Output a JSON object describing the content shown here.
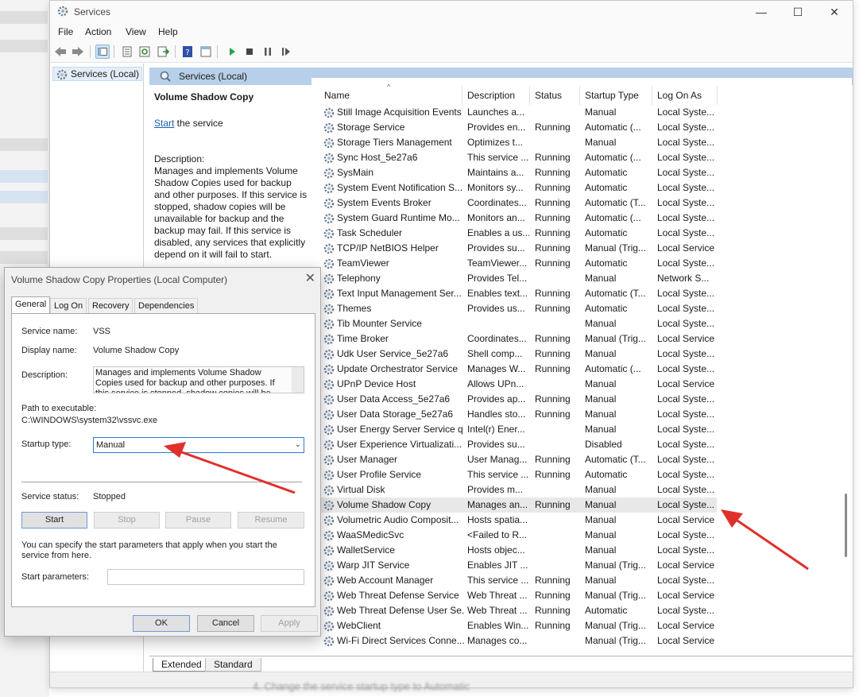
{
  "window": {
    "title": "Services",
    "controls": {
      "minimize": "—",
      "maximize": "☐",
      "close": "✕"
    }
  },
  "menu": [
    "File",
    "Action",
    "View",
    "Help"
  ],
  "toolbar_icons": [
    "back-icon",
    "forward-icon",
    "show-hide-console-tree-icon",
    "properties-icon",
    "refresh-icon",
    "export-list-icon",
    "help-icon",
    "view-icon",
    "start-service-icon",
    "stop-service-icon",
    "pause-service-icon",
    "resume-service-icon"
  ],
  "tree": {
    "item": "Services (Local)"
  },
  "pane_header": "Services (Local)",
  "details": {
    "title": "Volume Shadow Copy",
    "start_link": "Start",
    "start_suffix": " the service",
    "description_label": "Description:",
    "description": "Manages and implements Volume Shadow Copies used for backup and other purposes. If this service is stopped, shadow copies will be unavailable for backup and the backup may fail. If this service is disabled, any services that explicitly depend on it will fail to start."
  },
  "columns": [
    "Name",
    "Description",
    "Status",
    "Startup Type",
    "Log On As"
  ],
  "services": [
    {
      "name": "Still Image Acquisition Events",
      "desc": "Launches a...",
      "status": "",
      "startup": "Manual",
      "logon": "Local Syste..."
    },
    {
      "name": "Storage Service",
      "desc": "Provides en...",
      "status": "Running",
      "startup": "Automatic (...",
      "logon": "Local Syste..."
    },
    {
      "name": "Storage Tiers Management",
      "desc": "Optimizes t...",
      "status": "",
      "startup": "Manual",
      "logon": "Local Syste..."
    },
    {
      "name": "Sync Host_5e27a6",
      "desc": "This service ...",
      "status": "Running",
      "startup": "Automatic (...",
      "logon": "Local Syste..."
    },
    {
      "name": "SysMain",
      "desc": "Maintains a...",
      "status": "Running",
      "startup": "Automatic",
      "logon": "Local Syste..."
    },
    {
      "name": "System Event Notification S...",
      "desc": "Monitors sy...",
      "status": "Running",
      "startup": "Automatic",
      "logon": "Local Syste..."
    },
    {
      "name": "System Events Broker",
      "desc": "Coordinates...",
      "status": "Running",
      "startup": "Automatic (T...",
      "logon": "Local Syste..."
    },
    {
      "name": "System Guard Runtime Mo...",
      "desc": "Monitors an...",
      "status": "Running",
      "startup": "Automatic (...",
      "logon": "Local Syste..."
    },
    {
      "name": "Task Scheduler",
      "desc": "Enables a us...",
      "status": "Running",
      "startup": "Automatic",
      "logon": "Local Syste..."
    },
    {
      "name": "TCP/IP NetBIOS Helper",
      "desc": "Provides su...",
      "status": "Running",
      "startup": "Manual (Trig...",
      "logon": "Local Service"
    },
    {
      "name": "TeamViewer",
      "desc": "TeamViewer...",
      "status": "Running",
      "startup": "Automatic",
      "logon": "Local Syste..."
    },
    {
      "name": "Telephony",
      "desc": "Provides Tel...",
      "status": "",
      "startup": "Manual",
      "logon": "Network S..."
    },
    {
      "name": "Text Input Management Ser...",
      "desc": "Enables text...",
      "status": "Running",
      "startup": "Automatic (T...",
      "logon": "Local Syste..."
    },
    {
      "name": "Themes",
      "desc": "Provides us...",
      "status": "Running",
      "startup": "Automatic",
      "logon": "Local Syste..."
    },
    {
      "name": "Tib Mounter Service",
      "desc": "",
      "status": "",
      "startup": "Manual",
      "logon": "Local Syste..."
    },
    {
      "name": "Time Broker",
      "desc": "Coordinates...",
      "status": "Running",
      "startup": "Manual (Trig...",
      "logon": "Local Service"
    },
    {
      "name": "Udk User Service_5e27a6",
      "desc": "Shell comp...",
      "status": "Running",
      "startup": "Manual",
      "logon": "Local Syste..."
    },
    {
      "name": "Update Orchestrator Service",
      "desc": "Manages W...",
      "status": "Running",
      "startup": "Automatic (...",
      "logon": "Local Syste..."
    },
    {
      "name": "UPnP Device Host",
      "desc": "Allows UPn...",
      "status": "",
      "startup": "Manual",
      "logon": "Local Service"
    },
    {
      "name": "User Data Access_5e27a6",
      "desc": "Provides ap...",
      "status": "Running",
      "startup": "Manual",
      "logon": "Local Syste..."
    },
    {
      "name": "User Data Storage_5e27a6",
      "desc": "Handles sto...",
      "status": "Running",
      "startup": "Manual",
      "logon": "Local Syste..."
    },
    {
      "name": "User Energy Server Service q...",
      "desc": "Intel(r) Ener...",
      "status": "",
      "startup": "Manual",
      "logon": "Local Syste..."
    },
    {
      "name": "User Experience Virtualizati...",
      "desc": "Provides su...",
      "status": "",
      "startup": "Disabled",
      "logon": "Local Syste..."
    },
    {
      "name": "User Manager",
      "desc": "User Manag...",
      "status": "Running",
      "startup": "Automatic (T...",
      "logon": "Local Syste..."
    },
    {
      "name": "User Profile Service",
      "desc": "This service ...",
      "status": "Running",
      "startup": "Automatic",
      "logon": "Local Syste..."
    },
    {
      "name": "Virtual Disk",
      "desc": "Provides m...",
      "status": "",
      "startup": "Manual",
      "logon": "Local Syste..."
    },
    {
      "name": "Volume Shadow Copy",
      "desc": "Manages an...",
      "status": "Running",
      "startup": "Manual",
      "logon": "Local Syste...",
      "selected": true
    },
    {
      "name": "Volumetric Audio Composit...",
      "desc": "Hosts spatia...",
      "status": "",
      "startup": "Manual",
      "logon": "Local Service"
    },
    {
      "name": "WaaSMedicSvc",
      "desc": "<Failed to R...",
      "status": "",
      "startup": "Manual",
      "logon": "Local Syste..."
    },
    {
      "name": "WalletService",
      "desc": "Hosts objec...",
      "status": "",
      "startup": "Manual",
      "logon": "Local Syste..."
    },
    {
      "name": "Warp JIT Service",
      "desc": "Enables JIT ...",
      "status": "",
      "startup": "Manual (Trig...",
      "logon": "Local Service"
    },
    {
      "name": "Web Account Manager",
      "desc": "This service ...",
      "status": "Running",
      "startup": "Manual",
      "logon": "Local Syste..."
    },
    {
      "name": "Web Threat Defense Service",
      "desc": "Web Threat ...",
      "status": "Running",
      "startup": "Manual (Trig...",
      "logon": "Local Service"
    },
    {
      "name": "Web Threat Defense User Se...",
      "desc": "Web Threat ...",
      "status": "Running",
      "startup": "Automatic",
      "logon": "Local Syste..."
    },
    {
      "name": "WebClient",
      "desc": "Enables Win...",
      "status": "Running",
      "startup": "Manual (Trig...",
      "logon": "Local Service"
    },
    {
      "name": "Wi-Fi Direct Services Conne...",
      "desc": "Manages co...",
      "status": "",
      "startup": "Manual (Trig...",
      "logon": "Local Service"
    }
  ],
  "bottom_tabs": [
    "Extended",
    "Standard"
  ],
  "background_caption": "4. Change the service startup type to Automatic",
  "dialog": {
    "title": "Volume Shadow Copy Properties (Local Computer)",
    "tabs": [
      "General",
      "Log On",
      "Recovery",
      "Dependencies"
    ],
    "service_name_label": "Service name:",
    "service_name": "VSS",
    "display_name_label": "Display name:",
    "display_name": "Volume Shadow Copy",
    "description_label": "Description:",
    "description": "Manages and implements Volume Shadow Copies used for backup and other purposes. If this service is stopped, shadow copies will be unavailable for backup and the backup may fail.",
    "path_label": "Path to executable:",
    "path": "C:\\WINDOWS\\system32\\vssvc.exe",
    "startup_type_label": "Startup type:",
    "startup_type": "Manual",
    "service_status_label": "Service status:",
    "service_status": "Stopped",
    "buttons": {
      "start": "Start",
      "stop": "Stop",
      "pause": "Pause",
      "resume": "Resume"
    },
    "hint": "You can specify the start parameters that apply when you start the service from here.",
    "start_params_label": "Start parameters:",
    "ok": "OK",
    "cancel": "Cancel",
    "apply": "Apply"
  },
  "colors": {
    "accent": "#2a78d6",
    "annotation_arrow": "#e0302c",
    "header_band": "#b7cfe8"
  }
}
